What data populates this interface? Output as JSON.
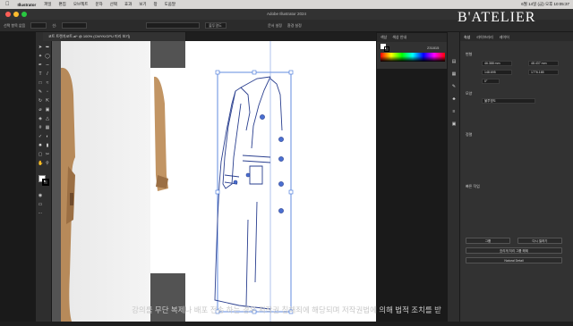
{
  "menubar": {
    "app": "Illustrator",
    "items": [
      "파일",
      "편집",
      "오브젝트",
      "문자",
      "선택",
      "효과",
      "보기",
      "창",
      "도움말"
    ],
    "clock": "6월 14일 (금) 오후 10:05:37"
  },
  "window": {
    "title": "Adobe Illustrator 2024"
  },
  "control": {
    "label1": "선택 항목 없음",
    "stroke": "선:",
    "style": "불투명도",
    "doc": "문서 설정",
    "pref": "환경 설정"
  },
  "document": {
    "tab": "코트 트렌치코트.ai* @ 100% (CMYK/GPU 미리 보기)"
  },
  "color_panel": {
    "tabs": [
      "색상",
      "색상 안내"
    ],
    "hex": "231815"
  },
  "properties": {
    "tabs": [
      "속성",
      "라이브러리",
      "레이어"
    ],
    "section_transform": "변형",
    "x": "46.388 mm",
    "y": "48.437 mm",
    "w": "148.695",
    "h": "1776.165",
    "angle": "0°",
    "section_appearance": "모양",
    "opacity_label": "불투명도",
    "section_align": "정렬",
    "section_quick": "빠른 작업",
    "btn_group": "그룹",
    "btn_expand": "다시 칠하기",
    "btn_recolor": "흐리게 처리 그룹 해제",
    "btn_image": "Natural Detail"
  },
  "brand": {
    "logo": "B'ATELIER"
  },
  "caption": {
    "text": "강의를 무단 복제나 배포 전송 하는 경우 저작권 침해죄에 해당되며 저작권법에 의해 법적 조치를 받"
  }
}
